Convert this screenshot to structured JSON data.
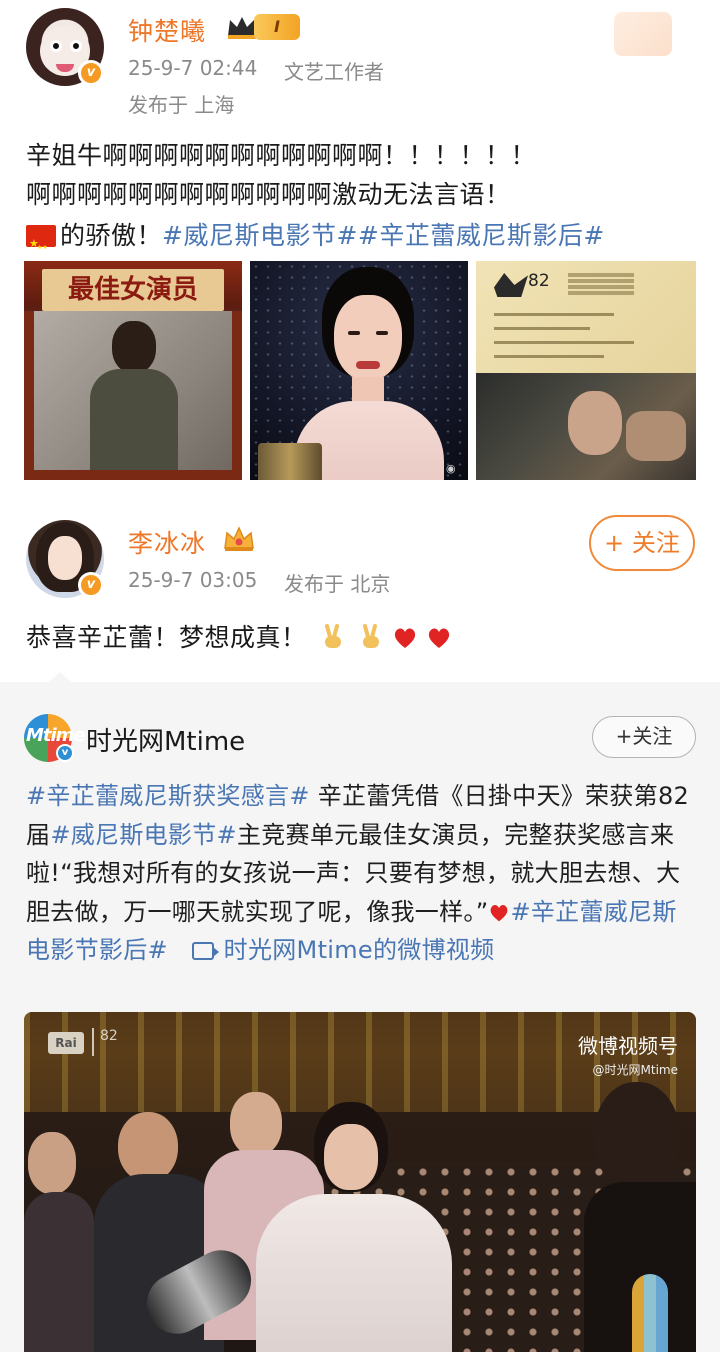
{
  "post1": {
    "author": "钟楚曦",
    "level_badge": "I",
    "time": "25-9-7 02:44",
    "category": "文艺工作者",
    "location": "发布于 上海",
    "line1": "辛姐牛啊啊啊啊啊啊啊啊啊啊啊！！！！！！",
    "line2": "啊啊啊啊啊啊啊啊啊啊啊啊激动无法言语！",
    "line3_text": "的骄傲！",
    "line3_tags": "#威尼斯电影节##辛芷蕾威尼斯影后#",
    "images": {
      "img1_caption": "最佳女演员",
      "img3_num": "82"
    }
  },
  "post2": {
    "author": "李冰冰",
    "time": "25-9-7 03:05",
    "location": "发布于 北京",
    "follow_label": "+ 关注",
    "text": "恭喜辛芷蕾！梦想成真！"
  },
  "repost": {
    "author": "时光网Mtime",
    "logo_text": "Mtime",
    "follow_label": "+关注",
    "tag1": "#辛芷蕾威尼斯获奖感言#",
    "text1": " 辛芷蕾凭借《日掛中天》荣获第82届",
    "tag2": "#威尼斯电影节#",
    "text2": "主竞赛单元最佳女演员，完整获奖感言来啦!“我想对所有的女孩说一声：只要有梦想，就大胆去想、大胆去做，万一哪天就实现了呢，像我一样。”",
    "tag3": "#辛芷蕾威尼斯电影节影后#",
    "video_link": "时光网Mtime的微博视频",
    "video": {
      "watermark": "微博视频号",
      "watermark_sub": "@时光网Mtime",
      "rai": "Rai",
      "lion_num": "82"
    }
  },
  "colors": {
    "name_orange": "#ee7628",
    "tag_blue": "#4a77b4",
    "meta_gray": "#8a8a8a",
    "repost_bg": "#f5f5f5"
  }
}
